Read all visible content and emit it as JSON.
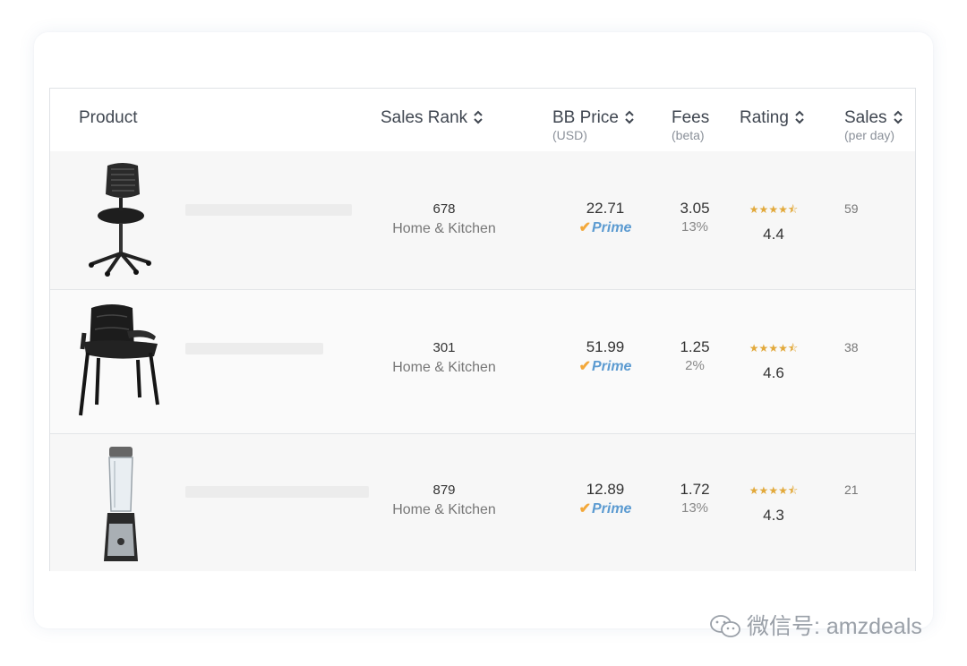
{
  "table": {
    "headers": {
      "product": "Product",
      "sales_rank": "Sales Rank",
      "bb_price": "BB Price",
      "bb_price_sub": "(USD)",
      "fees": "Fees",
      "fees_sub": "(beta)",
      "rating": "Rating",
      "sales": "Sales",
      "sales_sub": "(per day)"
    },
    "rows": [
      {
        "image": "office-chair-mesh-icon",
        "rank": "678",
        "category": "Home & Kitchen",
        "price": "22.71",
        "prime": "Prime",
        "fee": "3.05",
        "fee_pct": "13%",
        "stars": "★★★★⯪",
        "rating": "4.4",
        "sales": "59"
      },
      {
        "image": "leather-guest-chair-icon",
        "rank": "301",
        "category": "Home & Kitchen",
        "price": "51.99",
        "prime": "Prime",
        "fee": "1.25",
        "fee_pct": "2%",
        "stars": "★★★★⯪",
        "rating": "4.6",
        "sales": "38"
      },
      {
        "image": "personal-blender-icon",
        "rank": "879",
        "category": "Home & Kitchen",
        "price": "12.89",
        "prime": "Prime",
        "fee": "1.72",
        "fee_pct": "13%",
        "stars": "★★★★⯪",
        "rating": "4.3",
        "sales": "21"
      }
    ]
  },
  "watermark": {
    "text": "微信号: amzdeals",
    "icon": "wechat-icon"
  },
  "colors": {
    "prime_blue": "#5c9bd1",
    "prime_check": "#f3a83a",
    "star": "#e2a93b",
    "row_bg": "#f7f7f7"
  }
}
